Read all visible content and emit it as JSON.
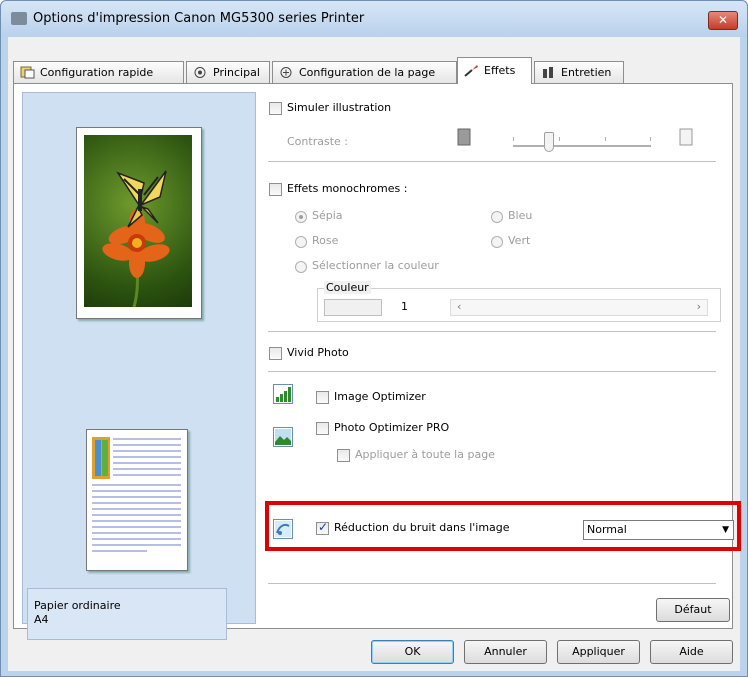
{
  "window": {
    "title": "Options d'impression Canon MG5300 series Printer",
    "close_label": "✕"
  },
  "tabs": [
    {
      "label": "Configuration rapide"
    },
    {
      "label": "Principal"
    },
    {
      "label": "Configuration de la page"
    },
    {
      "label": "Effets"
    },
    {
      "label": "Entretien"
    }
  ],
  "active_tab": "Effets",
  "left": {
    "paper_type": "Papier ordinaire",
    "paper_size": "A4"
  },
  "effects": {
    "simulate_illustration": {
      "label": "Simuler illustration",
      "checked": false
    },
    "contrast_label": "Contraste :",
    "mono": {
      "label": "Effets monochromes :",
      "checked": false
    },
    "radio_sepia": "Sépia",
    "radio_bleu": "Bleu",
    "radio_rose": "Rose",
    "radio_vert": "Vert",
    "radio_select_color": "Sélectionner la couleur",
    "color_group_label": "Couleur",
    "color_value": "1",
    "color_left_arrow": "‹",
    "color_right_arrow": "›",
    "vivid": {
      "label": "Vivid Photo",
      "checked": false
    },
    "image_optimizer": {
      "label": "Image Optimizer",
      "checked": false
    },
    "photo_optimizer": {
      "label": "Photo Optimizer PRO",
      "checked": false
    },
    "apply_all_pages": {
      "label": "Appliquer à toute la page",
      "checked": false
    },
    "noise_reduction": {
      "label": "Réduction du bruit dans l'image",
      "checked": true
    },
    "noise_level": "Normal"
  },
  "buttons": {
    "default": "Défaut",
    "ok": "OK",
    "cancel": "Annuler",
    "apply": "Appliquer",
    "help": "Aide"
  },
  "colors": {
    "highlight": "#e00000",
    "panel_bg": "#cfe0f3"
  }
}
